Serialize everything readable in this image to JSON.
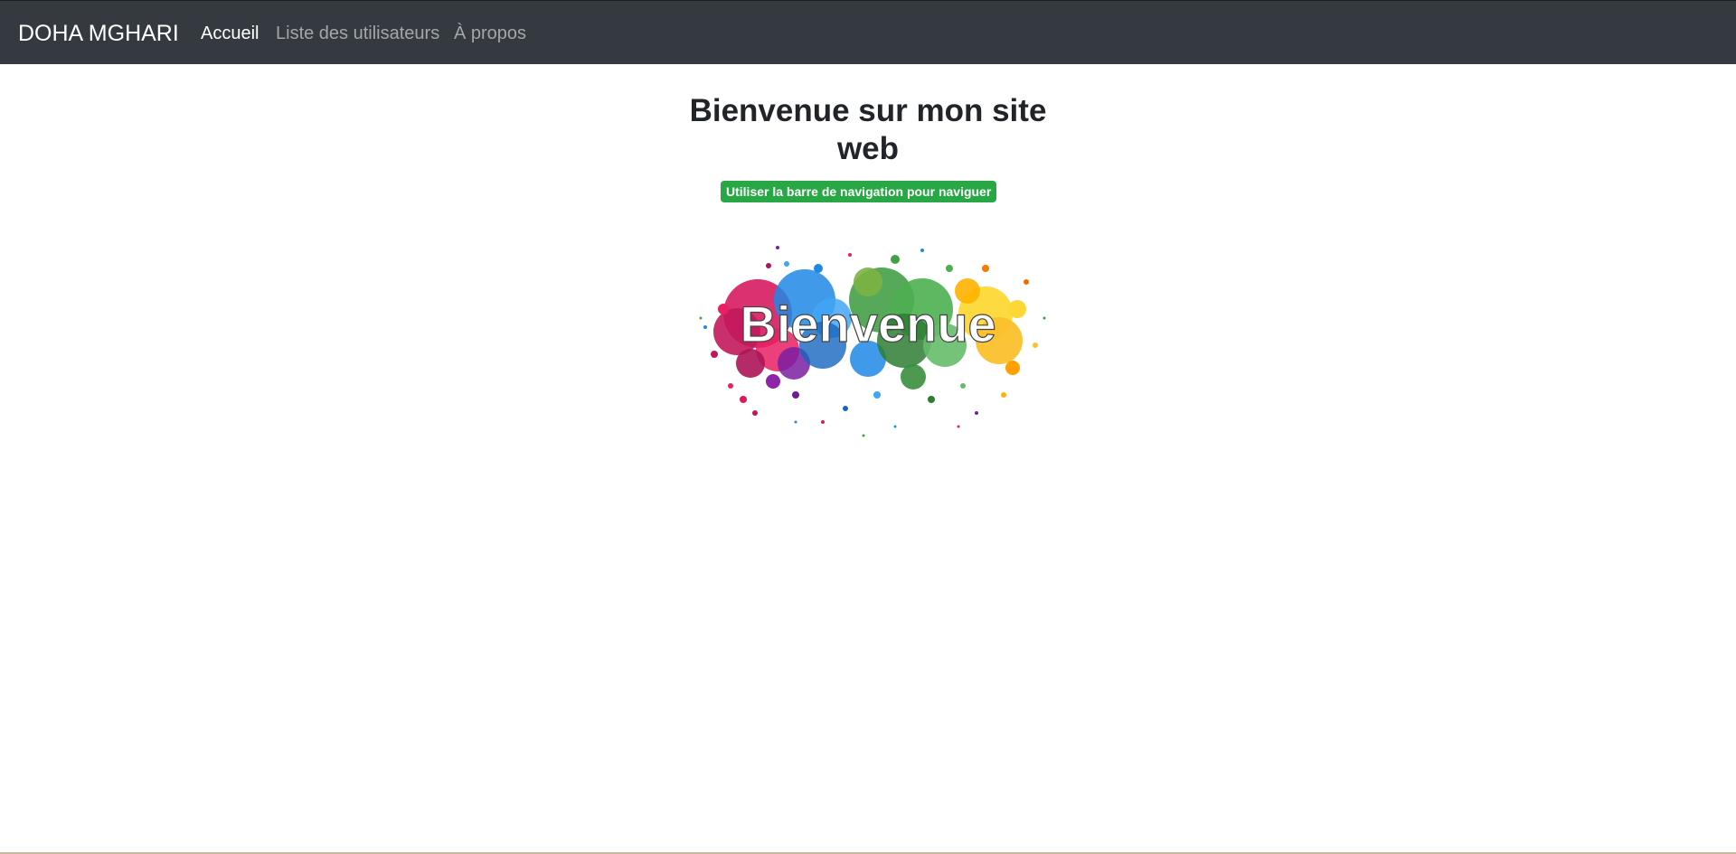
{
  "navbar": {
    "brand": "DOHA MGHARI",
    "items": [
      {
        "label": "Accueil",
        "active": true
      },
      {
        "label": "Liste des utilisateurs",
        "active": false
      },
      {
        "label": "À propos",
        "active": false
      }
    ]
  },
  "main": {
    "title": "Bienvenue sur mon site web",
    "badge": "Utiliser la barre de navigation pour naviguer",
    "hero_text": "Bienvenue"
  },
  "colors": {
    "navbar_bg": "#343a40",
    "badge_bg": "#28a745",
    "title_text": "#212529"
  }
}
